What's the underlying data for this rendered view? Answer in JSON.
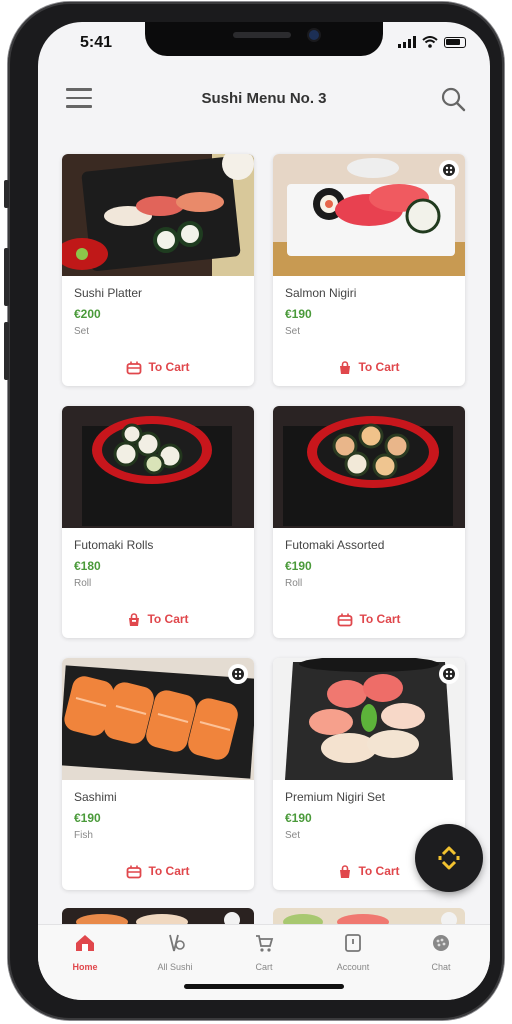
{
  "status": {
    "time": "5:41"
  },
  "header": {
    "title": "Sushi Menu No. 3"
  },
  "products": [
    {
      "name": "Sushi Platter",
      "price": "€200",
      "meta": "Set",
      "cart_label": "To Cart"
    },
    {
      "name": "Salmon Nigiri",
      "price": "€190",
      "meta": "Set",
      "cart_label": "To Cart"
    },
    {
      "name": "Futomaki Rolls",
      "price": "€180",
      "meta": "Roll",
      "cart_label": "To Cart"
    },
    {
      "name": "Futomaki Assorted",
      "price": "€190",
      "meta": "Roll",
      "cart_label": "To Cart"
    },
    {
      "name": "Sashimi",
      "price": "€190",
      "meta": "Fish",
      "cart_label": "To Cart"
    },
    {
      "name": "Premium Nigiri Set",
      "price": "€190",
      "meta": "Set",
      "cart_label": "To Cart"
    }
  ],
  "tabs": [
    {
      "label": "Home"
    },
    {
      "label": "All Sushi"
    },
    {
      "label": "Cart"
    },
    {
      "label": "Account"
    },
    {
      "label": "Chat"
    }
  ],
  "icons": {
    "menu": "hamburger-icon",
    "search": "search-icon",
    "cart": "cart-icon",
    "favorite": "favorite-icon",
    "fab": "diamond-icon"
  },
  "colors": {
    "accent": "#e0474c",
    "price": "#4a9a3a",
    "fab_icon": "#f2c230"
  }
}
